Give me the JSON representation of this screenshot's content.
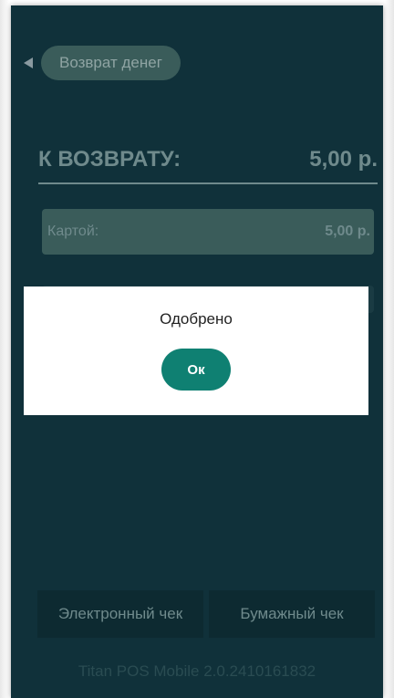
{
  "header": {
    "back_label": "Возврат денег"
  },
  "refund": {
    "label": "К ВОЗВРАТУ:",
    "amount": "5,00 р."
  },
  "payments": [
    {
      "method": "Картой:",
      "amount": "5,00 р."
    }
  ],
  "dialog": {
    "message": "Одобрено",
    "ok_label": "Ок"
  },
  "bottom": {
    "electronic_receipt": "Электронный чек",
    "paper_receipt": "Бумажный чек"
  },
  "footer": {
    "version": "Titan POS Mobile 2.0.2410161832"
  },
  "colors": {
    "background": "#10313a",
    "accent": "#0f8072",
    "dialog": "#ffffff"
  }
}
